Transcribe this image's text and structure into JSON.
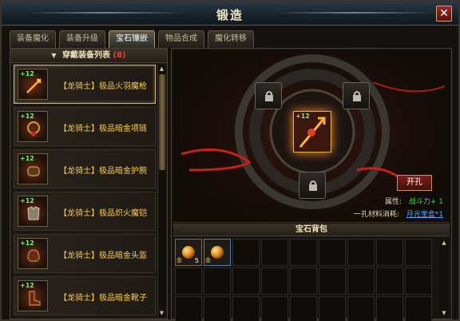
{
  "window": {
    "title": "锻造",
    "close": "✕"
  },
  "tabs": [
    "装备魔化",
    "装备升级",
    "宝石镶嵌",
    "物品合成",
    "魔化转移"
  ],
  "active_tab": 2,
  "equip_list": {
    "header": "穿戴装备列表",
    "count": "(8)",
    "items": [
      {
        "level": "+12",
        "name": "【龙骑士】极品火羽魔枪"
      },
      {
        "level": "+12",
        "name": "【龙骑士】极品暗金项链"
      },
      {
        "level": "+12",
        "name": "【龙骑士】极品暗金护腕"
      },
      {
        "level": "+12",
        "name": "【龙骑士】极品炽火魔铠"
      },
      {
        "level": "+12",
        "name": "【龙骑士】极品暗金头盔"
      },
      {
        "level": "+12",
        "name": "【龙骑士】极品暗金靴子"
      }
    ]
  },
  "forge": {
    "center_level": "+12",
    "open_button": "开孔",
    "attribute_label": "属性:",
    "attribute_value": "战斗力+ 1",
    "cost_label": "一孔材料消耗:",
    "cost_link": "月光宝盒*1"
  },
  "gem_bag": {
    "title": "宝石背包",
    "items": [
      {
        "tag": "金",
        "qty": "5"
      },
      {
        "tag": "金",
        "qty": ""
      }
    ]
  },
  "colors": {
    "item_name": "#ffcf4a",
    "level": "#7cf06a",
    "attr": "#41d64d",
    "link": "#4ea6ff"
  }
}
